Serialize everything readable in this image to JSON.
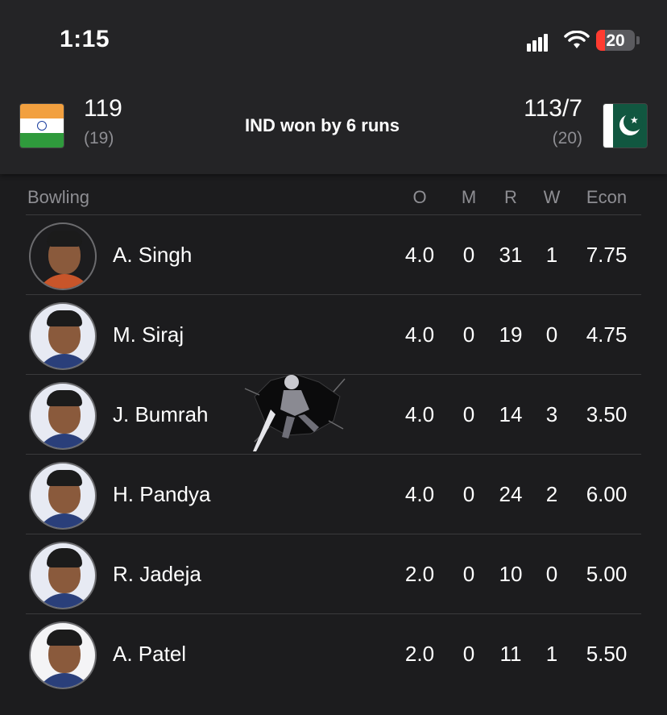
{
  "status_bar": {
    "time": "1:15",
    "battery_level": "20",
    "battery_color": "#ff3b30"
  },
  "match": {
    "team_left": {
      "flag_icon": "india-flag-icon",
      "score": "119",
      "overs": "(19)"
    },
    "team_right": {
      "flag_icon": "pakistan-flag-icon",
      "score": "113/7",
      "overs": "(20)"
    },
    "result": "IND won by 6 runs"
  },
  "bowling": {
    "headers": {
      "name": "Bowling",
      "o": "O",
      "m": "M",
      "r": "R",
      "w": "W",
      "econ": "Econ"
    },
    "rows": [
      {
        "name": "A. Singh",
        "o": "4.0",
        "m": "0",
        "r": "31",
        "w": "1",
        "econ": "7.75"
      },
      {
        "name": "M. Siraj",
        "o": "4.0",
        "m": "0",
        "r": "19",
        "w": "0",
        "econ": "4.75"
      },
      {
        "name": "J. Bumrah",
        "o": "4.0",
        "m": "0",
        "r": "14",
        "w": "3",
        "econ": "3.50"
      },
      {
        "name": "H. Pandya",
        "o": "4.0",
        "m": "0",
        "r": "24",
        "w": "2",
        "econ": "6.00"
      },
      {
        "name": "R. Jadeja",
        "o": "2.0",
        "m": "0",
        "r": "10",
        "w": "0",
        "econ": "5.00"
      },
      {
        "name": "A. Patel",
        "o": "2.0",
        "m": "0",
        "r": "11",
        "w": "1",
        "econ": "5.50"
      }
    ]
  }
}
